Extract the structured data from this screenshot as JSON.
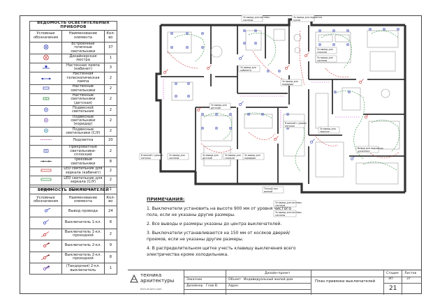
{
  "lighting_table": {
    "title": "ВЕДОМОСТЬ ОСВЕТИТЕЛЬНЫХ ПРИБОРОВ",
    "headers": [
      "Условные обозначения",
      "Наименование элемента",
      "Кол-во"
    ],
    "rows": [
      {
        "name": "Встроенные точечные светильники",
        "qty": "37",
        "icon": "recessed-spot"
      },
      {
        "name": "Дизайнерская люстра",
        "qty": "1",
        "icon": "chandelier"
      },
      {
        "name": "Настенная лампа (кабинет)",
        "qty": "3",
        "icon": "wall-lamp"
      },
      {
        "name": "Настенная телескопическая лампа",
        "qty": "2",
        "icon": "telescopic-lamp"
      },
      {
        "name": "Настенные светильники",
        "qty": "2",
        "icon": "wall-light"
      },
      {
        "name": "Настенные светильники (детская)",
        "qty": "2",
        "icon": "wall-light-kids"
      },
      {
        "name": "Подвесной светильник",
        "qty": "2",
        "icon": "pendant"
      },
      {
        "name": "Подвесные светильники (коридор)",
        "qty": "2",
        "icon": "pendant-corridor"
      },
      {
        "name": "Подвесные светильники (С/У)",
        "qty": "2",
        "icon": "pendant-wc"
      },
      {
        "name": "Подсветка",
        "qty": "20",
        "icon": "backlight"
      },
      {
        "name": "Прикроватные светильники-сплоский",
        "qty": "2",
        "icon": "bedside"
      },
      {
        "name": "Трековые светильники",
        "qty": "8",
        "icon": "track"
      },
      {
        "name": "LED светильник для зеркала (кабинет)",
        "qty": "2",
        "icon": "led-mirror-cab"
      },
      {
        "name": "LED светильник для зеркала (С/У)",
        "qty": "2",
        "icon": "led-mirror-wc"
      },
      {
        "name": "Шинопровод",
        "qty": "1",
        "icon": "busbar"
      }
    ]
  },
  "switch_table": {
    "title": "ВЕДОМОСТЬ ВЫКЛЮЧАТЕЛЕЙ",
    "headers": [
      "Условные обозначения",
      "Наименование элемента",
      "Кол-во"
    ],
    "rows": [
      {
        "name": "Вывод провода",
        "qty": "24",
        "icon": "wire-out"
      },
      {
        "name": "Выключатель 1-кл.",
        "qty": "8",
        "icon": "switch-1"
      },
      {
        "name": "Выключатель 1-кл. проходной",
        "qty": "2",
        "icon": "switch-1-pass"
      },
      {
        "name": "Выключатель 2-кл.",
        "qty": "9",
        "icon": "switch-2"
      },
      {
        "name": "Выключатель 2-кл. проходной",
        "qty": "8",
        "icon": "switch-2-pass"
      },
      {
        "name": "(Тандорная) 2-кл. выключатель",
        "qty": "1",
        "icon": "switch-2-tandem"
      }
    ]
  },
  "notes": {
    "title": "ПРИМЕЧАНИЯ:",
    "items": [
      "1. Выключатели установить на высоте 900 мм от уровня чистого пола, если не указаны другие размеры.",
      "2. Все выводы и размеры указаны до центра выключателей.",
      "3. Выключатели устанавливаются на 150 мм от косяков дверей/проемов, если не указаны другие размеры.",
      "4. В распределительном щитке учесть клавишу выключения всего электричества кроме холодильника."
    ]
  },
  "plan": {
    "labels": {
      "wire_out": "3х вывод для системы",
      "wire_out_short": "3х вывод для",
      "wire_out_alt": "3х вывод для подсветки",
      "sub_system": "системы",
      "sub_cabinet": "кабинета",
      "sub_kids": "детской",
      "sub_bedroom": "спальни",
      "sub_kitchen": "кухни",
      "sub_corridor": "коридора",
      "sub_mirror": "зеркала",
      "wire_height": "В ванной с уровня",
      "wire_height_sub": "потолка",
      "side_note": "Вывод для подсветки",
      "side_note_sub": "кухонного",
      "warm_floor": "Теплый пол",
      "warm_floor_sub": "ванной"
    }
  },
  "title_block": {
    "company_line1": "техника",
    "company_line2": "архитектуры",
    "company_url": "tech-of-arch.com",
    "role_1": "Дизайн-проект",
    "label_designer": "Дизайнер",
    "designer_name": "Глав В.",
    "label_checked": "Заказчик",
    "label_object": "Объект",
    "object_name": "Индивидуальный жилой дом",
    "label_address": "Адрес",
    "sheet_title": "План привязки выключателей",
    "label_stage": "Стадия",
    "label_sheet": "Листов",
    "stage": "ЭП",
    "sheets": "37",
    "sheet_number": "21"
  }
}
